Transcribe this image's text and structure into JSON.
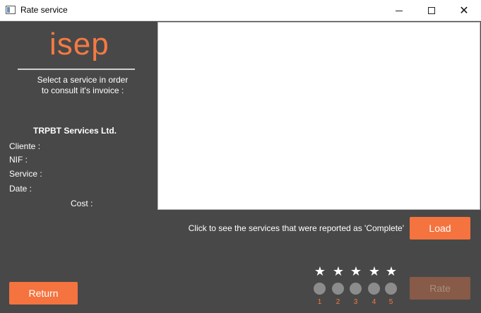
{
  "window": {
    "title": "Rate service",
    "icons": {
      "app": "window-icon",
      "minimize": "minimize-icon",
      "maximize": "maximize-icon",
      "close": "close-icon"
    }
  },
  "sidebar": {
    "logo_text": "isep",
    "instruction": "Select a service in order\nto consult it's invoice :",
    "company": "TRPBT Services Ltd.",
    "fields": {
      "cliente": "Cliente :",
      "nif": "NIF :",
      "service": "Service :",
      "date": "Date :",
      "cost": "Cost :"
    }
  },
  "main": {
    "load_hint": "Click to see the services that were reported as 'Complete'",
    "load_label": "Load"
  },
  "rating": {
    "options": [
      "1",
      "2",
      "3",
      "4",
      "5"
    ],
    "star_icon": "star-icon"
  },
  "actions": {
    "return_label": "Return",
    "rate_label": "Rate"
  },
  "colors": {
    "accent": "#f4733f",
    "background": "#484848",
    "disabled_button": "#875b47"
  }
}
